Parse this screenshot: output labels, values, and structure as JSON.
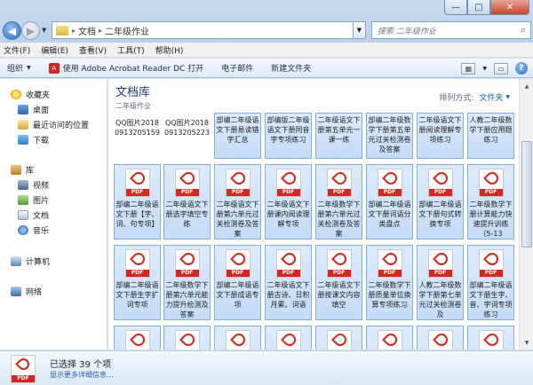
{
  "window": {
    "buttons": {
      "minimize": "—",
      "maximize": "□",
      "close": "✕"
    }
  },
  "address": {
    "path": [
      "文档",
      "二年级作业"
    ],
    "separator": "▸"
  },
  "search": {
    "placeholder": "搜索 二年级作业"
  },
  "menu": [
    "文件(F)",
    "编辑(E)",
    "查看(V)",
    "工具(T)",
    "帮助(H)"
  ],
  "toolbar": {
    "organize": "组织",
    "open_with": "使用 Adobe Acrobat Reader DC 打开",
    "email": "电子邮件",
    "new_folder": "新建文件夹"
  },
  "nav": {
    "favorites": "收藏夹",
    "desktop": "桌面",
    "recent": "最近访问的位置",
    "downloads": "下载",
    "libraries": "库",
    "videos": "视频",
    "pictures": "图片",
    "documents": "文档",
    "music": "音乐",
    "computer": "计算机",
    "network": "网络"
  },
  "library": {
    "title": "文档库",
    "subtitle": "二年级作业",
    "arrange_label": "排列方式:",
    "arrange_value": "文件夹"
  },
  "files_row0": [
    {
      "name": "QQ图片20180913205159",
      "plain": true
    },
    {
      "name": "QQ图片20180913205223",
      "plain": true
    },
    {
      "name": "部编二年级语文下册易读错字汇总"
    },
    {
      "name": "部编版二年级语文下册同音字专项练习"
    },
    {
      "name": "二年级语文下册第五单元一课一练"
    },
    {
      "name": "部编二年级数学下册第五单元过关检测卷及答案"
    },
    {
      "name": "二年级语文下册阅读理解专项练习"
    },
    {
      "name": "人教二年级数学下册应用题练习"
    }
  ],
  "files_row1": [
    {
      "name": "部编二年级语文下册【字、词、句专项】"
    },
    {
      "name": "二年级语文下册选字填空专练"
    },
    {
      "name": "二年级语文下册第六单元过关检测卷及答案"
    },
    {
      "name": "二年级语文下册课内阅读理解专项"
    },
    {
      "name": "二年级数学下册第六单元过关检测卷及答案"
    },
    {
      "name": "部编二年级语文下册词语分类盘点"
    },
    {
      "name": "部编二年级语文下册句式转换专项"
    },
    {
      "name": "二年级数学下册计算能力快速提升训练（5-13"
    }
  ],
  "files_row2": [
    {
      "name": "部编二年级语文下册生字扩词专项"
    },
    {
      "name": "二年级数学下册第六单元能力提升检测及答案"
    },
    {
      "name": "部编二年级语文下册成语专项"
    },
    {
      "name": "二年级语文下册古诗、日积月累、词语"
    },
    {
      "name": "二年级语文下册按课文内容填空"
    },
    {
      "name": "二年级数学下册质量单位换算专项练习"
    },
    {
      "name": "人教二年级数学下册第七单元过关检测卷及"
    },
    {
      "name": "部编二年级语文下册生字、音、字词专项练习"
    }
  ],
  "file_icon_label": "PDF",
  "details": {
    "selected": "已选择 39 个项",
    "more": "显示更多详细信息..."
  }
}
